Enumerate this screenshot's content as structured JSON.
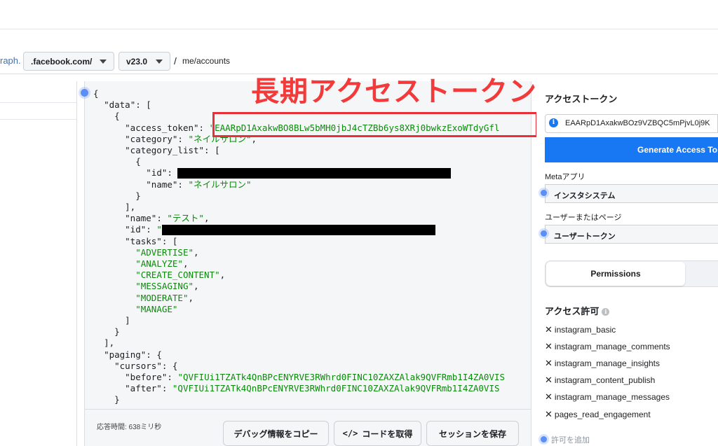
{
  "urlbar": {
    "prefix": "raph.",
    "domain_select": ".facebook.com/",
    "version_select": "v23.0",
    "separator": "/",
    "path": "me/accounts"
  },
  "annotation": {
    "title": "長期アクセストークン",
    "color": "#f23a3a"
  },
  "json_view": {
    "lines": [
      {
        "indent": 0,
        "text": "{"
      },
      {
        "indent": 1,
        "key": "\"data\"",
        "rest": ": ["
      },
      {
        "indent": 2,
        "text": "{"
      },
      {
        "indent": 3,
        "key": "\"access_token\"",
        "sep": ": ",
        "str": "\"EAARpD1AxakwBO8BLw5bMH0jbJ4cTZBb6ys8XRj0bwkzExoWTdyGfl"
      },
      {
        "indent": 3,
        "key": "\"category\"",
        "sep": ": ",
        "str": "\"ネイルサロン\"",
        "rest": ","
      },
      {
        "indent": 3,
        "key": "\"category_list\"",
        "rest": ": ["
      },
      {
        "indent": 4,
        "text": "{"
      },
      {
        "indent": 5,
        "key": "\"id\"",
        "sep": ": ",
        "redact": 390
      },
      {
        "indent": 5,
        "key": "\"name\"",
        "sep": ": ",
        "str": "\"ネイルサロン\""
      },
      {
        "indent": 4,
        "text": "}"
      },
      {
        "indent": 3,
        "text": "],"
      },
      {
        "indent": 3,
        "key": "\"name\"",
        "sep": ": ",
        "str": "\"テスト\"",
        "rest": ","
      },
      {
        "indent": 3,
        "key": "\"id\"",
        "sep": ": ",
        "str": "\"",
        "redact": 390
      },
      {
        "indent": 3,
        "key": "\"tasks\"",
        "rest": ": ["
      },
      {
        "indent": 4,
        "str": "\"ADVERTISE\"",
        "rest": ","
      },
      {
        "indent": 4,
        "str": "\"ANALYZE\"",
        "rest": ","
      },
      {
        "indent": 4,
        "str": "\"CREATE_CONTENT\"",
        "rest": ","
      },
      {
        "indent": 4,
        "str": "\"MESSAGING\"",
        "rest": ","
      },
      {
        "indent": 4,
        "str": "\"MODERATE\"",
        "rest": ","
      },
      {
        "indent": 4,
        "str": "\"MANAGE\""
      },
      {
        "indent": 3,
        "text": "]"
      },
      {
        "indent": 2,
        "text": "}"
      },
      {
        "indent": 1,
        "text": "],"
      },
      {
        "indent": 1,
        "key": "\"paging\"",
        "rest": ": {"
      },
      {
        "indent": 2,
        "key": "\"cursors\"",
        "rest": ": {"
      },
      {
        "indent": 3,
        "key": "\"before\"",
        "sep": ": ",
        "str": "\"QVFIUi1TZATk4QnBPcENYRVE3RWhrd0FINC10ZAXZAlak9QVFRmb1I4ZA0VIS"
      },
      {
        "indent": 3,
        "key": "\"after\"",
        "sep": ": ",
        "str": "\"QVFIUi1TZATk4QnBPcENYRVE3RWhrd0FINC10ZAXZAlak9QVFRmb1I4ZA0VIS"
      },
      {
        "indent": 2,
        "text": "}"
      }
    ]
  },
  "footer": {
    "response_time": "応答時間: 638ミリ秒",
    "copy_debug": "デバッグ情報をコピー",
    "get_code": "コードを取得",
    "save_session": "セッションを保存"
  },
  "right_panel": {
    "token_heading": "アクセストークン",
    "token_value": "EAARpD1AxakwBOz9VZBQC5mPjvL0j9K",
    "generate_button": "Generate Access To",
    "meta_app_label": "Metaアプリ",
    "meta_app_value": "インスタシステム",
    "user_page_label": "ユーザーまたはページ",
    "user_page_value": "ユーザートークン",
    "tab_permissions": "Permissions",
    "access_heading": "アクセス許可",
    "permissions": [
      "instagram_basic",
      "instagram_manage_comments",
      "instagram_manage_insights",
      "instagram_content_publish",
      "instagram_manage_messages",
      "pages_read_engagement"
    ],
    "add_permission": "許可を追加",
    "accent_color": "#1877f2"
  }
}
